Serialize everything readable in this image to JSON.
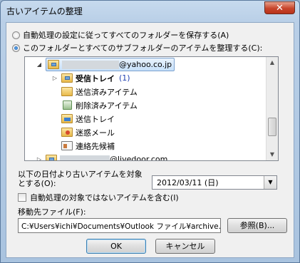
{
  "dialog": {
    "title": "古いアイテムの整理",
    "close_glyph": "✕"
  },
  "options": {
    "radio_auto": "自動処理の設定に従ってすべてのフォルダーを保存する(A)",
    "radio_this": "このフォルダーとすべてのサブフォルダーのアイテムを整理する(C):"
  },
  "tree": {
    "account1": "@yahoo.co.jp",
    "inbox": "受信トレイ",
    "inbox_count": "(1)",
    "sent_items": "送信済みアイテム",
    "deleted_items": "削除済みアイテム",
    "outbox": "送信トレイ",
    "junk": "迷惑メール",
    "contacts": "連絡先候補",
    "account2": "@livedoor.com"
  },
  "date": {
    "label_line1": "以下の日付より古いアイテムを対象とする(O):",
    "value": "2012/03/11 (日)"
  },
  "include_no_autoarchive": "自動処理の対象ではないアイテムを含む(I)",
  "destination": {
    "label": "移動先ファイル(F):",
    "path": "C:¥Users¥ichi¥Documents¥Outlook ファイル¥archive.pst",
    "browse": "参照(B)..."
  },
  "buttons": {
    "ok": "OK",
    "cancel": "キャンセル"
  }
}
